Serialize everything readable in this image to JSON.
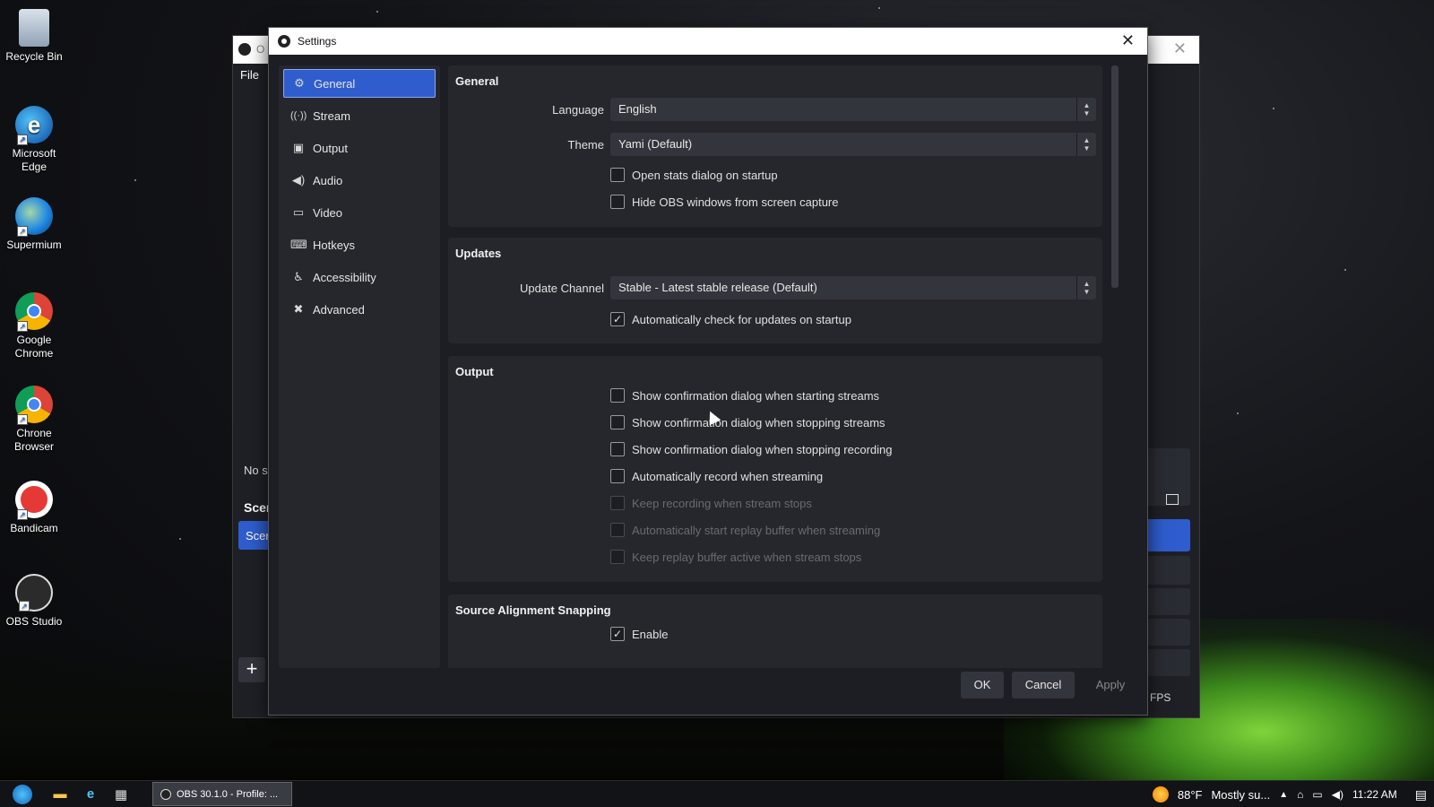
{
  "desktop": {
    "icons": [
      {
        "label": "Recycle Bin"
      },
      {
        "label": "Microsoft Edge"
      },
      {
        "label": "Supermium"
      },
      {
        "label": "Google Chrome"
      },
      {
        "label": "Chrone Browser"
      },
      {
        "label": "Bandicam"
      },
      {
        "label": "OBS Studio"
      }
    ]
  },
  "obs_main": {
    "title_partial": "O",
    "menu_file": "File",
    "no_source_partial": "No s",
    "scenes_partial": "Scer",
    "scene_item_partial": "Scer",
    "add_glyph": "+",
    "fps_text": "FPS"
  },
  "settings": {
    "title": "Settings",
    "close_glyph": "✕",
    "nav": [
      {
        "label": "General",
        "icon": "gear-icon",
        "glyph": "⚙"
      },
      {
        "label": "Stream",
        "icon": "antenna-icon",
        "glyph": "📡"
      },
      {
        "label": "Output",
        "icon": "output-icon",
        "glyph": "▣"
      },
      {
        "label": "Audio",
        "icon": "speaker-icon",
        "glyph": "🔊"
      },
      {
        "label": "Video",
        "icon": "monitor-icon",
        "glyph": "▭"
      },
      {
        "label": "Hotkeys",
        "icon": "keyboard-icon",
        "glyph": "⌨"
      },
      {
        "label": "Accessibility",
        "icon": "accessibility-icon",
        "glyph": "♿"
      },
      {
        "label": "Advanced",
        "icon": "tools-icon",
        "glyph": "✖"
      }
    ],
    "general": {
      "title": "General",
      "language_label": "Language",
      "language_value": "English",
      "theme_label": "Theme",
      "theme_value": "Yami (Default)",
      "open_stats_label": "Open stats dialog on startup",
      "open_stats_checked": false,
      "hide_obs_label": "Hide OBS windows from screen capture",
      "hide_obs_checked": false
    },
    "updates": {
      "title": "Updates",
      "channel_label": "Update Channel",
      "channel_value": "Stable - Latest stable release (Default)",
      "auto_check_label": "Automatically check for updates on startup",
      "auto_check_checked": true
    },
    "output": {
      "title": "Output",
      "options": [
        {
          "label": "Show confirmation dialog when starting streams",
          "checked": false,
          "disabled": false
        },
        {
          "label": "Show confirmation dialog when stopping streams",
          "checked": false,
          "disabled": false
        },
        {
          "label": "Show confirmation dialog when stopping recording",
          "checked": false,
          "disabled": false
        },
        {
          "label": "Automatically record when streaming",
          "checked": false,
          "disabled": false
        },
        {
          "label": "Keep recording when stream stops",
          "checked": false,
          "disabled": true
        },
        {
          "label": "Automatically start replay buffer when streaming",
          "checked": false,
          "disabled": true
        },
        {
          "label": "Keep replay buffer active when stream stops",
          "checked": false,
          "disabled": true
        }
      ]
    },
    "snapping": {
      "title": "Source Alignment Snapping",
      "enable_label": "Enable",
      "enable_checked": true
    },
    "buttons": {
      "ok": "OK",
      "cancel": "Cancel",
      "apply": "Apply"
    },
    "check_glyph": "✓"
  },
  "taskbar": {
    "app_label": "OBS 30.1.0 - Profile: ...",
    "weather_temp": "88°F",
    "weather_text": "Mostly su...",
    "time": "11:22 AM"
  }
}
